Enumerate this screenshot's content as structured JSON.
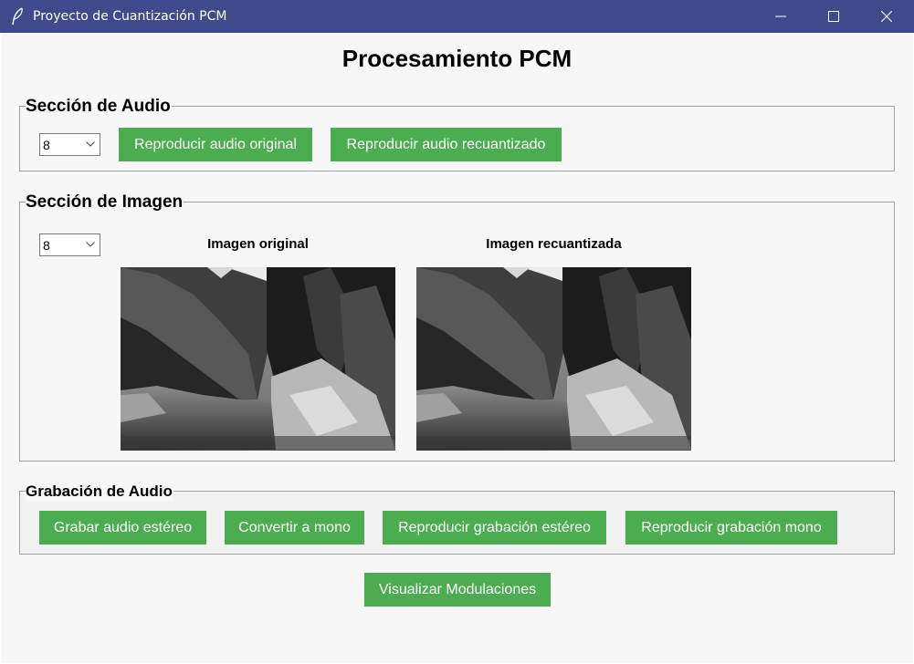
{
  "window": {
    "title": "Proyecto de Cuantización PCM"
  },
  "heading": "Procesamiento PCM",
  "audio_section": {
    "label": "Sección de Audio",
    "bits_selected": "8",
    "play_original_label": "Reproducir audio original",
    "play_requantized_label": "Reproducir audio recuantizado"
  },
  "image_section": {
    "label": "Sección de Imagen",
    "bits_selected": "8",
    "original_caption": "Imagen original",
    "requantized_caption": "Imagen recuantizada"
  },
  "recording_section": {
    "label": "Grabación de Audio",
    "record_stereo_label": "Grabar audio estéreo",
    "convert_mono_label": "Convertir a mono",
    "play_stereo_label": "Reproducir grabación estéreo",
    "play_mono_label": "Reproducir grabación mono"
  },
  "visualize_label": "Visualizar Modulaciones",
  "colors": {
    "titlebar": "#3e4a8c",
    "button": "#4cad50",
    "background": "#f7f7f7"
  },
  "icons": {
    "app": "feather-icon",
    "minimize": "minimize-icon",
    "maximize": "maximize-icon",
    "close": "close-icon",
    "dropdown": "chevron-down-icon"
  }
}
